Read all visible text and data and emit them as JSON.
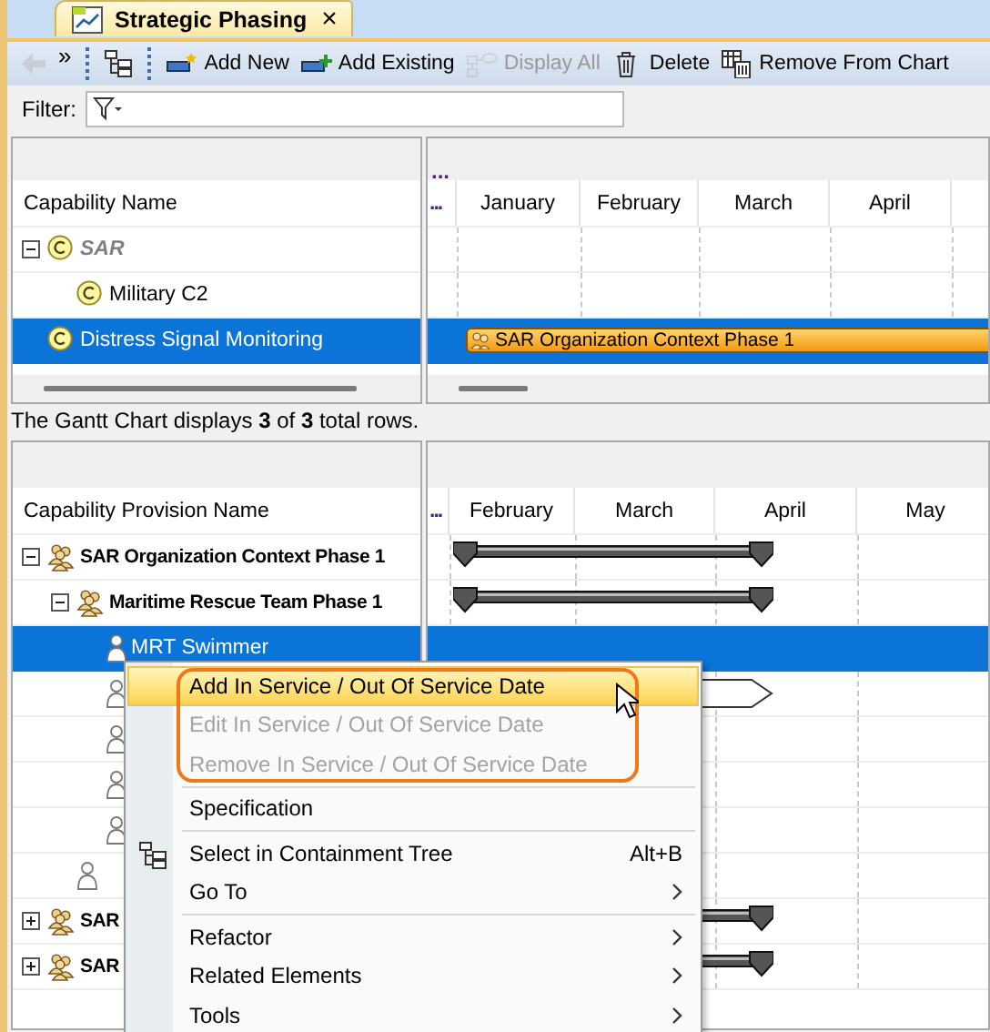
{
  "tab": {
    "title": "Strategic Phasing",
    "close": "×",
    "selected": true
  },
  "toolbar": [
    {
      "kind": "back",
      "disabled": true
    },
    {
      "kind": "overflow",
      "label": "»",
      "disabled": false
    },
    {
      "kind": "grip"
    },
    {
      "kind": "tree",
      "disabled": false
    },
    {
      "kind": "grip"
    },
    {
      "kind": "add-new",
      "label": "Add New",
      "disabled": false
    },
    {
      "kind": "add-existing",
      "label": "Add Existing",
      "disabled": false
    },
    {
      "kind": "display-all",
      "label": "Display All",
      "disabled": true
    },
    {
      "kind": "delete",
      "label": "Delete",
      "disabled": false
    },
    {
      "kind": "remove",
      "label": "Remove From Chart",
      "disabled": false
    }
  ],
  "filter": {
    "label": "Filter:"
  },
  "upper": {
    "name_column": "Capability Name",
    "top_mark": "...",
    "month_mark": "...",
    "months": [
      "January",
      "February",
      "March",
      "April"
    ],
    "rows": [
      {
        "name": "SAR",
        "kind": "capability",
        "abstract": true,
        "expanded": true,
        "selected": false,
        "children": [
          {
            "name": "Military C2",
            "kind": "capability",
            "abstract": false,
            "selected": false
          }
        ]
      },
      {
        "name": "Distress Signal Monitoring",
        "kind": "capability",
        "abstract": false,
        "selected": true,
        "bar": {
          "kind": "label",
          "label": "SAR Organization Context Phase 1"
        }
      }
    ]
  },
  "status": "The Gantt Chart displays **3** of **3** total rows.",
  "lower": {
    "name_column": "Capability Provision Name",
    "month_mark": "...",
    "months": [
      "February",
      "March",
      "April",
      "May"
    ],
    "rows": [
      {
        "name": "SAR Organization Context Phase 1",
        "kind": "org",
        "expanded": true,
        "selected": false,
        "bar": {
          "kind": "span"
        },
        "children": [
          {
            "name": "Maritime Rescue Team Phase 1",
            "kind": "org",
            "expanded": true,
            "selected": false,
            "bar": {
              "kind": "span"
            },
            "children": [
              {
                "name": "MRT Swimmer",
                "kind": "person",
                "selected": true
              },
              {
                "kind": "person",
                "selected": false,
                "bar": {
                  "kind": "arrow"
                }
              },
              {
                "kind": "person",
                "selected": false
              },
              {
                "kind": "person",
                "selected": false
              },
              {
                "kind": "person",
                "selected": false
              }
            ]
          },
          {
            "kind": "person",
            "selected": false
          }
        ]
      },
      {
        "name": "SAR",
        "kind": "org",
        "expanded": false,
        "selected": false,
        "bar": {
          "kind": "span"
        }
      },
      {
        "name": "SAR",
        "kind": "org",
        "expanded": false,
        "selected": false,
        "bar": {
          "kind": "span"
        }
      }
    ]
  },
  "menu": {
    "items": [
      {
        "kind": "item",
        "label": "Add In Service / Out Of Service Date",
        "selected": true,
        "disabled": false,
        "outlined": true
      },
      {
        "kind": "item",
        "label": "Edit In Service / Out Of Service Date",
        "selected": false,
        "disabled": true,
        "outlined": true
      },
      {
        "kind": "item",
        "label": "Remove In Service / Out Of Service Date",
        "selected": false,
        "disabled": true,
        "outlined": true
      },
      {
        "kind": "separator"
      },
      {
        "kind": "item",
        "label": "Specification",
        "selected": false,
        "disabled": false
      },
      {
        "kind": "separator"
      },
      {
        "kind": "item",
        "label": "Select in Containment Tree",
        "shortcut": "Alt+B",
        "icon": true,
        "selected": false,
        "disabled": false
      },
      {
        "kind": "item",
        "label": "Go To",
        "submenu": true,
        "selected": false,
        "disabled": false
      },
      {
        "kind": "separator"
      },
      {
        "kind": "item",
        "label": "Refactor",
        "submenu": true,
        "selected": false,
        "disabled": false
      },
      {
        "kind": "item",
        "label": "Related Elements",
        "submenu": true,
        "selected": false,
        "disabled": false
      },
      {
        "kind": "item",
        "label": "Tools",
        "submenu": true,
        "selected": false,
        "disabled": false
      }
    ]
  }
}
